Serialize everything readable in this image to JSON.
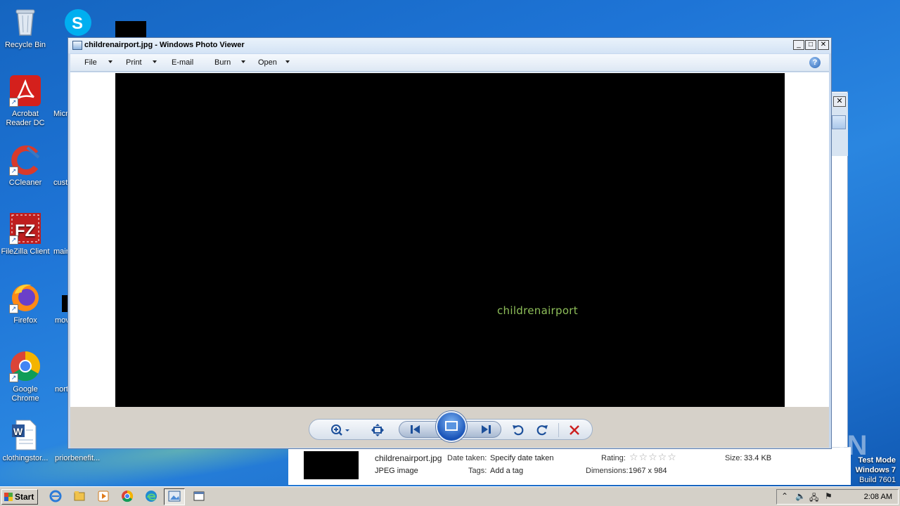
{
  "desktop": {
    "icons": [
      {
        "label": "Recycle Bin",
        "icon": "recycle-bin-icon"
      },
      {
        "label": "Acrobat Reader DC",
        "icon": "acrobat-icon"
      },
      {
        "label": "CCleaner",
        "icon": "ccleaner-icon"
      },
      {
        "label": "FileZilla Client",
        "icon": "filezilla-icon"
      },
      {
        "label": "Firefox",
        "icon": "firefox-icon"
      },
      {
        "label": "Google Chrome",
        "icon": "chrome-icon"
      },
      {
        "label": "clothingstor...",
        "icon": "word-doc-icon"
      }
    ],
    "second_column": [
      {
        "label": "Micr"
      },
      {
        "label": "cust"
      },
      {
        "label": "mair"
      },
      {
        "label": "mov"
      },
      {
        "label": "nort"
      },
      {
        "label": "priorbenefit..."
      }
    ]
  },
  "window": {
    "title": "childrenairport.jpg - Windows Photo Viewer",
    "menu": {
      "file": "File",
      "print": "Print",
      "email": "E-mail",
      "burn": "Burn",
      "open": "Open"
    },
    "image_text": "childrenairport",
    "help": "?"
  },
  "controls": {
    "zoom": "zoom-icon",
    "fit": "actual-size-icon",
    "previous": "previous-icon",
    "slideshow": "slideshow-icon",
    "next": "next-icon",
    "rotate_ccw": "rotate-counterclockwise-icon",
    "rotate_cw": "rotate-clockwise-icon",
    "delete": "delete-icon"
  },
  "details_pane": {
    "filename": "childrenairport.jpg",
    "filetype": "JPEG image",
    "date_taken_label": "Date taken:",
    "date_taken_value": "Specify date taken",
    "tags_label": "Tags:",
    "tags_value": "Add a tag",
    "rating_label": "Rating:",
    "rating_stars": "☆☆☆☆☆",
    "dimensions_label": "Dimensions:",
    "dimensions_value": "1967 x 984",
    "size_label": "Size:",
    "size_value": "33.4 KB"
  },
  "watermark": "ANY RUN",
  "test_mode": {
    "line1": "Test Mode",
    "line2": "Windows 7",
    "line3": "Build 7601"
  },
  "taskbar": {
    "start": "Start",
    "clock": "2:08 AM"
  }
}
